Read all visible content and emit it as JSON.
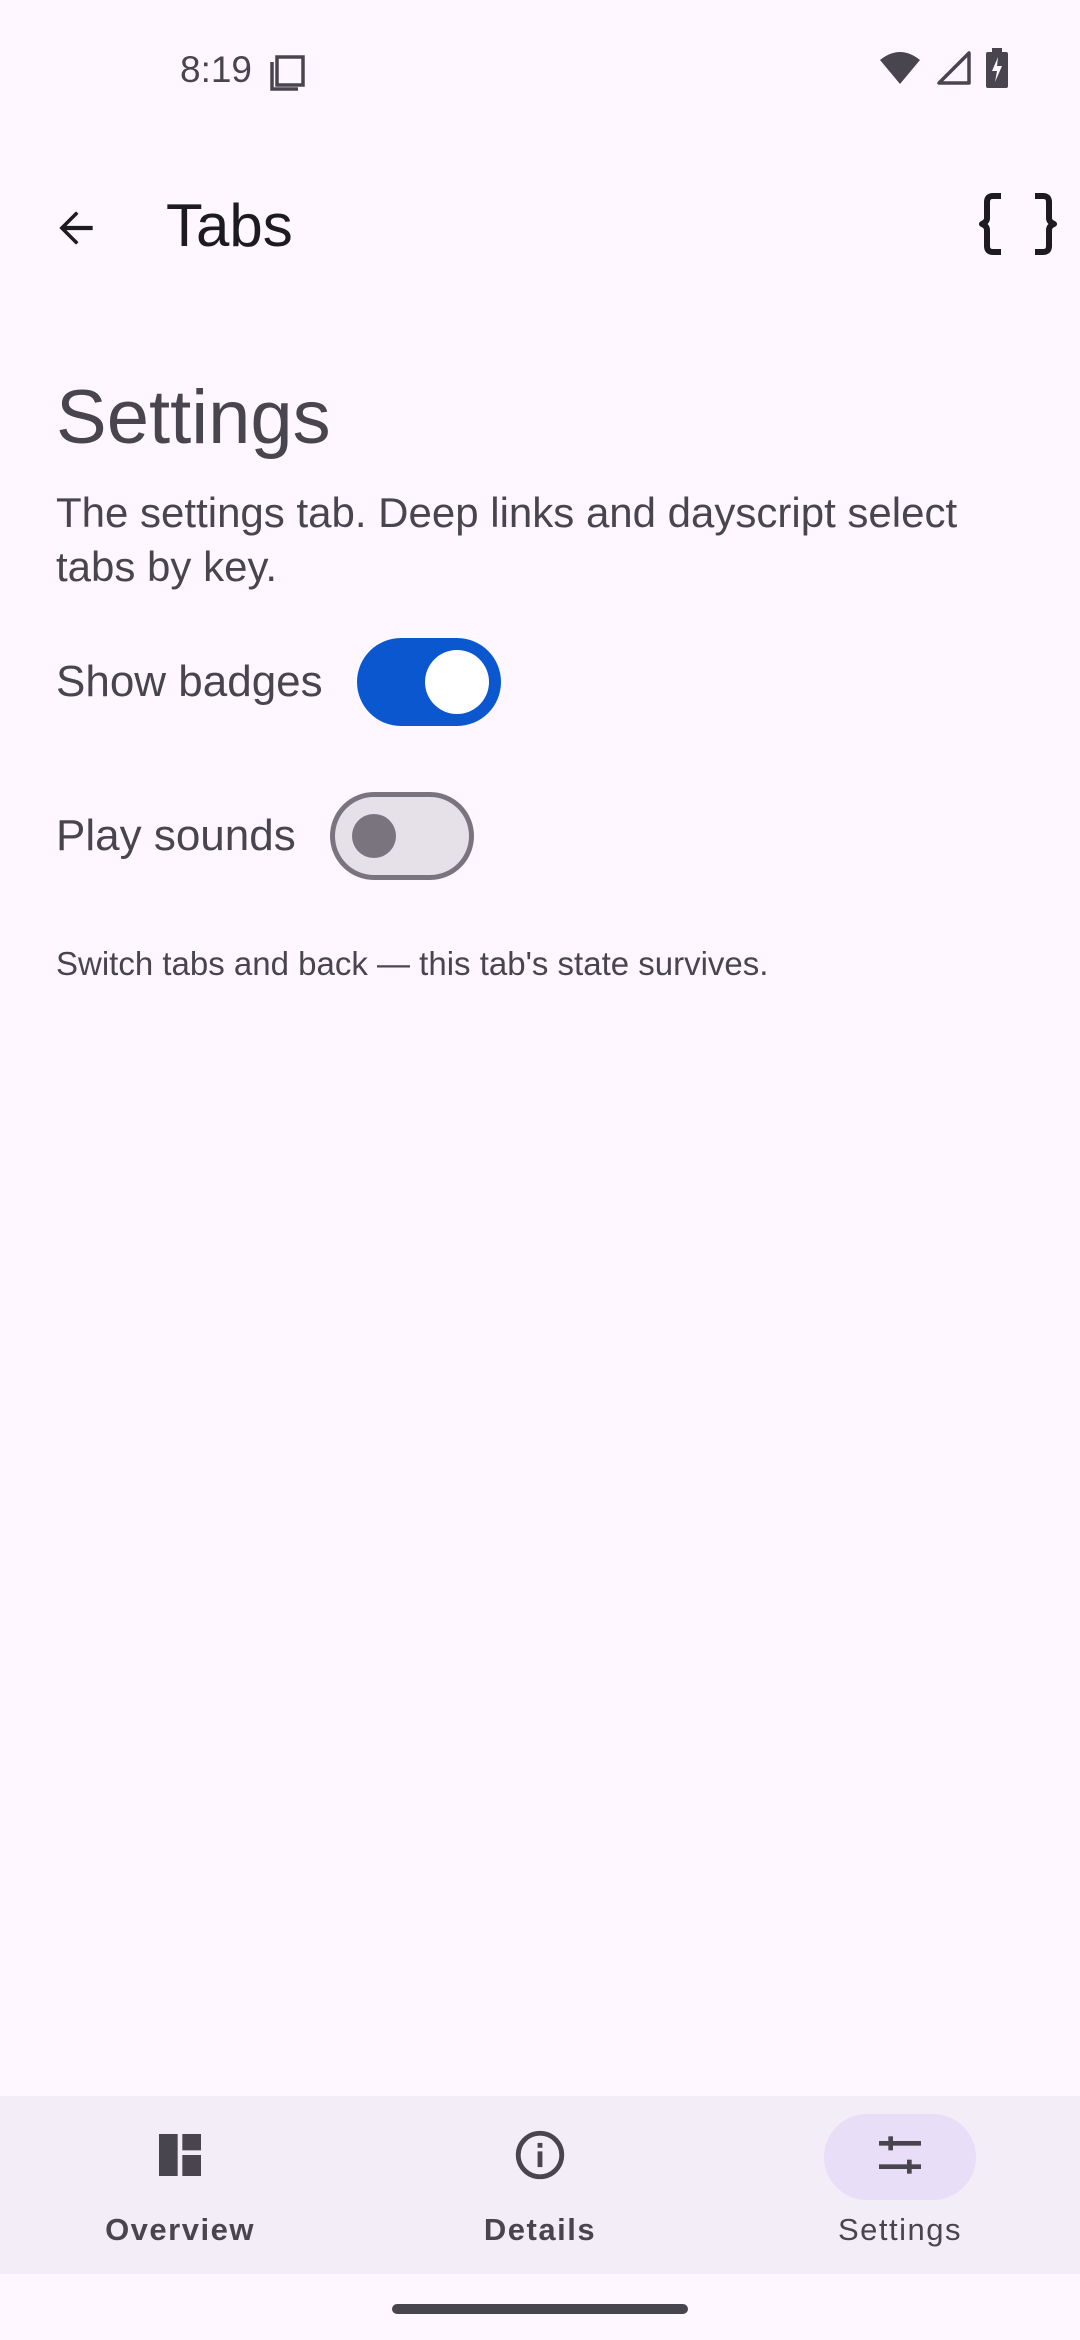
{
  "status_bar": {
    "time": "8:19",
    "icons": [
      "sim-card-icon",
      "wifi-icon",
      "cell-signal-icon",
      "battery-charging-icon"
    ]
  },
  "app_bar": {
    "title": "Tabs",
    "back_icon": "arrow-back-icon",
    "action_icon": "code-braces-icon"
  },
  "content": {
    "title": "Settings",
    "description": "The settings tab. Deep links and dayscript select tabs by key.",
    "settings": [
      {
        "label": "Show badges",
        "enabled": true
      },
      {
        "label": "Play sounds",
        "enabled": false
      }
    ],
    "footnote": "Switch tabs and back — this tab's state survives."
  },
  "bottom_nav": {
    "items": [
      {
        "label": "Overview",
        "icon": "dashboard-icon",
        "selected": false
      },
      {
        "label": "Details",
        "icon": "info-icon",
        "selected": false
      },
      {
        "label": "Settings",
        "icon": "tune-icon",
        "selected": true
      }
    ]
  },
  "colors": {
    "background": "#FEF7FF",
    "switch_on": "#0B57D0",
    "nav_background": "#F3EDF7",
    "nav_indicator": "#E8DEF8",
    "text_primary": "#1D1B20",
    "text_secondary": "#49454F"
  }
}
